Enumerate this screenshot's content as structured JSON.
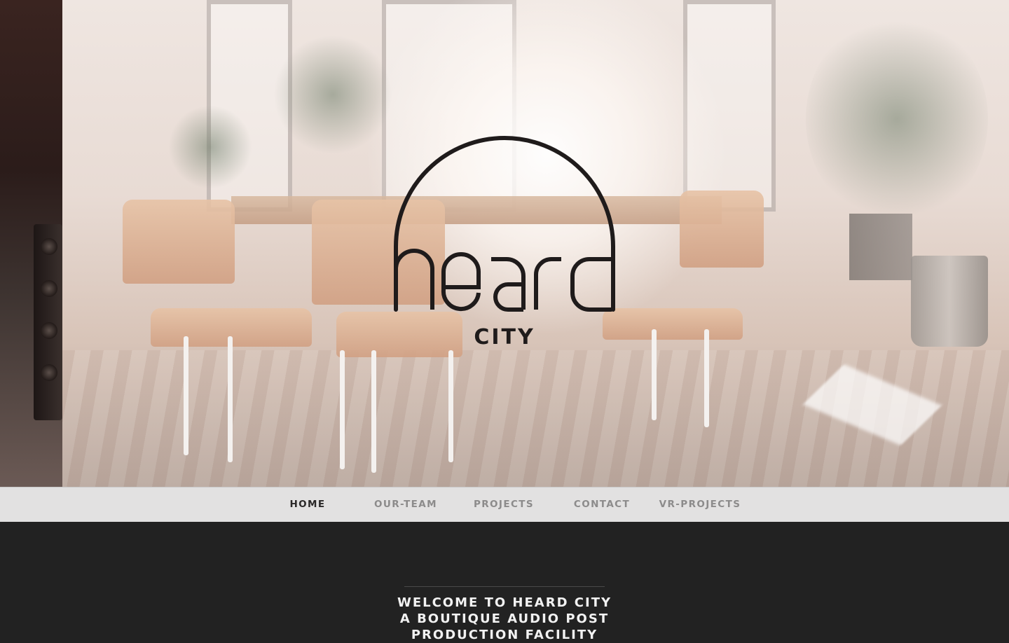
{
  "hero": {
    "logo_word": "heard",
    "logo_subword": "CITY"
  },
  "nav": {
    "items": [
      {
        "label": "HOME",
        "active": true
      },
      {
        "label": "OUR-TEAM",
        "active": false
      },
      {
        "label": "PROJECTS",
        "active": false
      },
      {
        "label": "CONTACT",
        "active": false
      },
      {
        "label": "VR-PROJECTS",
        "active": false
      }
    ]
  },
  "content": {
    "welcome_lines": [
      "WELCOME TO HEARD CITY",
      "A BOUTIQUE AUDIO POST",
      "PRODUCTION FACILITY"
    ]
  },
  "colors": {
    "nav_background": "#e2e1e1",
    "nav_active": "#2a2828",
    "nav_inactive": "#8c8b8b",
    "content_background": "#222222",
    "logo": "#1f1b1b"
  }
}
